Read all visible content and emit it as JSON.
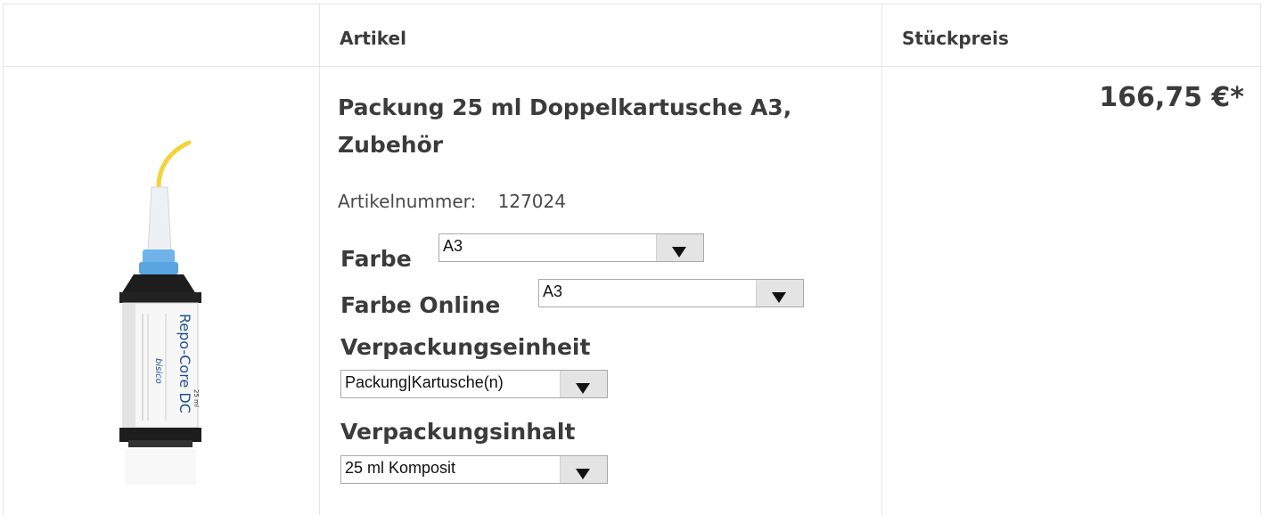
{
  "table": {
    "headers": {
      "article": "Artikel",
      "unit_price": "Stückpreis"
    }
  },
  "product": {
    "title": "Packung 25 ml Doppelkartusche A3, Zubehör",
    "article_number_label": "Artikelnummer:",
    "article_number": "127024",
    "price": "166,75 €*",
    "image_label": "Repo-Core DC",
    "image_brand": "bisico",
    "image_volume": "25 ml"
  },
  "options": {
    "farbe": {
      "label": "Farbe",
      "selected": "A3"
    },
    "farbe_online": {
      "label": "Farbe Online",
      "selected": "A3"
    },
    "verpackungseinheit": {
      "label": "Verpackungseinheit",
      "selected": "Packung|Kartusche(n)"
    },
    "verpackungsinhalt": {
      "label": "Verpackungsinhalt",
      "selected": "25 ml Komposit"
    }
  },
  "icons": {
    "dropdown": "chevron-down-icon"
  },
  "colors": {
    "border": "#e6e6e6",
    "text": "#3b3b3b",
    "select_button": "#e4e4e4",
    "nozzle_tip": "#f4d23a",
    "mixer_cap": "#6fb3e8"
  }
}
